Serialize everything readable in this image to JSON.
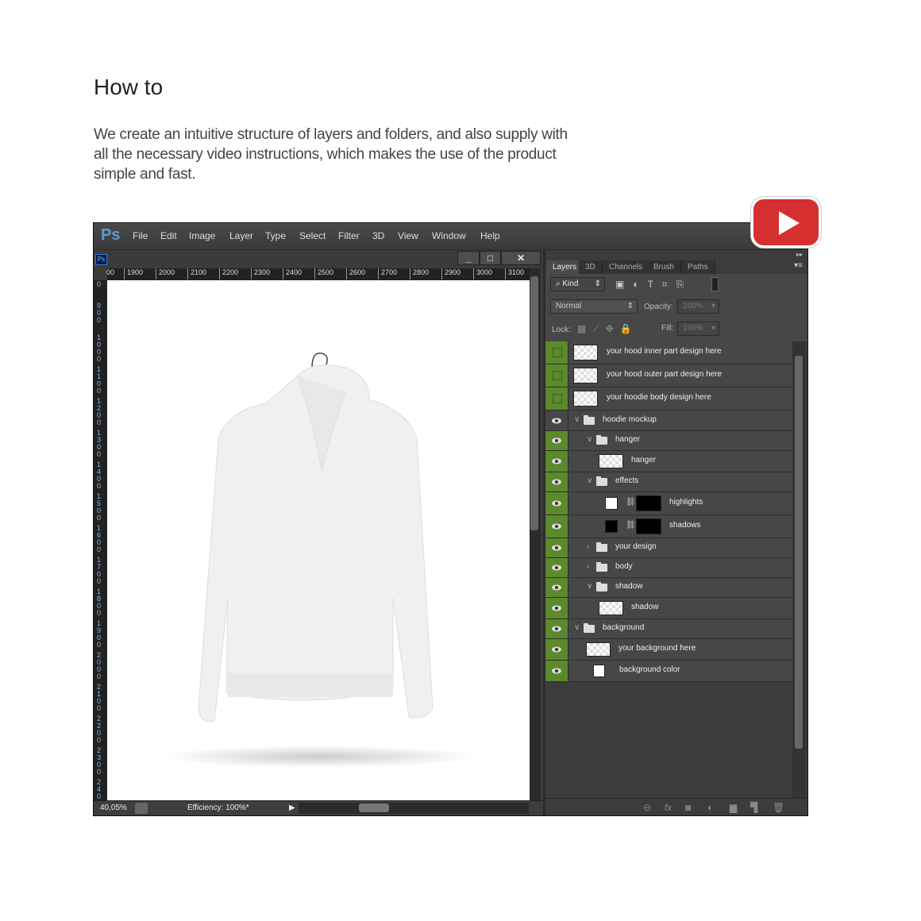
{
  "heading": "How to",
  "description": "We create an intuitive structure of layers and folders, and also supply with all the necessary video instructions, which makes the use of the product simple and fast.",
  "youtube": {
    "icon": "play-icon",
    "color": "#d52f2f"
  },
  "app": {
    "logo": "Ps",
    "menu": [
      "File",
      "Edit",
      "Image",
      "Layer",
      "Type",
      "Select",
      "Filter",
      "3D",
      "View",
      "Window",
      "Help"
    ]
  },
  "document": {
    "doc_icon": "Ps",
    "h_ruler": [
      "00",
      "1900",
      "2000",
      "2100",
      "2200",
      "2300",
      "2400",
      "2500",
      "2600",
      "2700",
      "2800",
      "2900",
      "3000",
      "3100"
    ],
    "v_ruler": [
      "0",
      "900",
      "1000",
      "1100",
      "1200",
      "1300",
      "1400",
      "1500",
      "1600",
      "1700",
      "1800",
      "1900",
      "2000",
      "2100",
      "2200",
      "2300",
      "2400"
    ],
    "zoom": "40,05%",
    "efficiency": "Efficiency: 100%*"
  },
  "panel": {
    "tabs": [
      "Layers",
      "3D",
      "Channels",
      "Brush",
      "Paths"
    ],
    "filter_kind": "Kind",
    "blend_mode": "Normal",
    "opacity_label": "Opacity:",
    "opacity": "100%",
    "lock_label": "Lock:",
    "fill_label": "Fill:",
    "fill": "100%",
    "accent": "#5b8a2c",
    "layers": [
      {
        "name": "your hood inner part design here",
        "type": "smart",
        "visible": false,
        "indent": 0
      },
      {
        "name": "your hood outer part design here",
        "type": "smart",
        "visible": false,
        "indent": 0
      },
      {
        "name": "your hoodie body design here",
        "type": "smart",
        "visible": false,
        "indent": 0
      },
      {
        "name": "hoodie mockup",
        "type": "group",
        "open": true,
        "visible": true,
        "indent": 0,
        "selected": true
      },
      {
        "name": "hanger",
        "type": "group",
        "open": true,
        "visible": true,
        "indent": 1
      },
      {
        "name": "hanger",
        "type": "layer",
        "visible": true,
        "indent": 2
      },
      {
        "name": "effects",
        "type": "group",
        "open": true,
        "visible": true,
        "indent": 1
      },
      {
        "name": "highlights",
        "type": "masked",
        "fill": "white",
        "visible": true,
        "indent": 2
      },
      {
        "name": "shadows",
        "type": "masked",
        "fill": "black",
        "visible": true,
        "indent": 2
      },
      {
        "name": "your design",
        "type": "group",
        "open": false,
        "visible": true,
        "indent": 1
      },
      {
        "name": "body",
        "type": "group",
        "open": false,
        "visible": true,
        "indent": 1
      },
      {
        "name": "shadow",
        "type": "group",
        "open": true,
        "visible": true,
        "indent": 1
      },
      {
        "name": "shadow",
        "type": "layer",
        "visible": true,
        "indent": 2
      },
      {
        "name": "background",
        "type": "group",
        "open": true,
        "visible": true,
        "indent": 0
      },
      {
        "name": "your background here",
        "type": "layer",
        "visible": true,
        "indent": 1
      },
      {
        "name": "background color",
        "type": "solid",
        "visible": true,
        "indent": 1
      }
    ]
  }
}
